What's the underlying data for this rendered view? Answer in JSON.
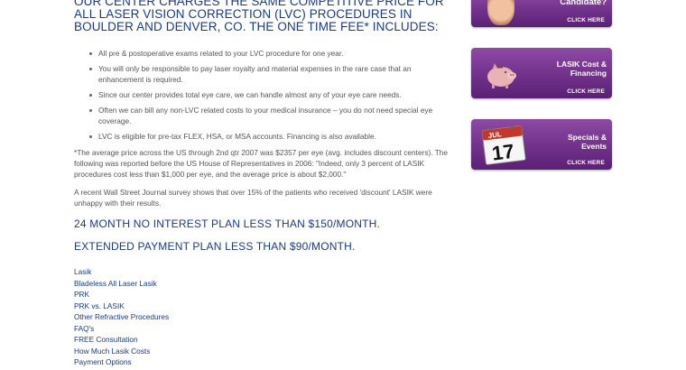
{
  "main": {
    "headline": "OUR CENTER CHARGES THE SAME COMPETITIVE PRICE FOR ALL LASER VISION CORRECTION (LVC) PROCEDURES IN BOULDER AND DENVER, CO. THE ONE TIME FEE* INCLUDES:",
    "includes": [
      "All pre & postoperative exams related to your LVC procedure for one year.",
      "You will only be responsible to pay laser royalty and material expenses in the rare case that an enhancement is required.",
      "Since our center provides total eye care, we can handle almost any of your eye care needs.",
      "Often we can bill any non-LVC related costs to your medical insurance – you do not need special eye coverage.",
      "LVC is eligible for pre-tax FLEX, HSA, or MSA accounts. Financing is also available."
    ],
    "footnote": "*The average price across the US through 2nd qtr 2007 was $2357 per eye (avg. includes discount centers). The following was reported before the US House of Representatives in 2006: \"Indeed, only 3 percent of LASIK procedures cost less than $1,000 per eye, and the average price is about $2,000.\"",
    "wsj_note": "A recent Wall Street Journal survey shows that over 15% of the patients who received 'discount' LASIK were unhappy with their results.",
    "plan_24_month": "24 MONTH NO INTEREST PLAN LESS THAN $150/MONTH.",
    "plan_extended": "EXTENDED PAYMENT PLAN LESS THAN $90/MONTH.",
    "links": [
      "Lasik",
      "Bladeless All Laser Lasik",
      "PRK",
      "PRK vs. LASIK",
      "Other Refractive Procedures",
      "FAQ's",
      "FREE Consultation",
      "How Much Lasik Costs",
      "Payment Options"
    ]
  },
  "sidebar": {
    "candidate": {
      "title": "Candidate?",
      "cta": "CLICK HERE"
    },
    "cost": {
      "title_line1": "LASIK Cost &",
      "title_line2": "Financing",
      "cta": "CLICK HERE"
    },
    "specials": {
      "title_line1": "Specials &",
      "title_line2": "Events",
      "cta": "CLICK HERE",
      "calendar_month": "JUL",
      "calendar_day": "17"
    }
  },
  "colors": {
    "heading_blue": "#1a3a8a",
    "promo_purple": "#6e2f88",
    "calendar_red": "#c0392b"
  }
}
